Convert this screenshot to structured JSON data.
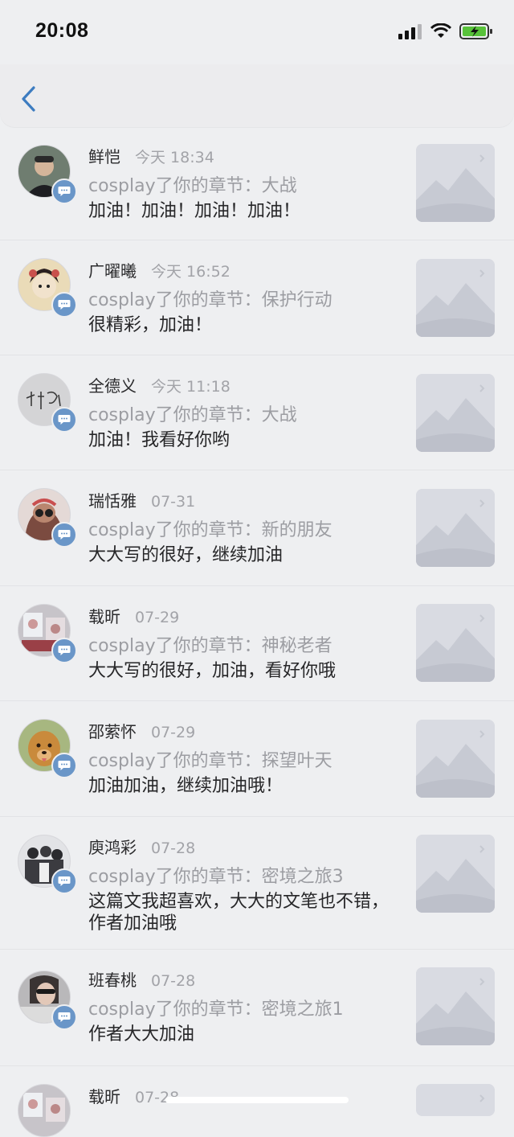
{
  "status_bar": {
    "time": "20:08"
  },
  "nav": {
    "back_icon": "chevron-left-icon"
  },
  "notifications": [
    {
      "name": "鲜恺",
      "time": "今天 18:34",
      "action": "cosplay了你的章节：大战",
      "comment": "加油！加油！加油！加油！"
    },
    {
      "name": "广曜曦",
      "time": "今天 16:52",
      "action": "cosplay了你的章节：保护行动",
      "comment": "很精彩，加油！"
    },
    {
      "name": "全德义",
      "time": "今天 11:18",
      "action": "cosplay了你的章节：大战",
      "comment": "加油！我看好你哟"
    },
    {
      "name": "瑞恬雅",
      "time": "07-31",
      "action": "cosplay了你的章节：新的朋友",
      "comment": "大大写的很好，继续加油"
    },
    {
      "name": "载昕",
      "time": "07-29",
      "action": "cosplay了你的章节：神秘老者",
      "comment": "大大写的很好，加油，看好你哦"
    },
    {
      "name": "邵萦怀",
      "time": "07-29",
      "action": "cosplay了你的章节：探望叶天",
      "comment": "加油加油，继续加油哦！"
    },
    {
      "name": "庾鸿彩",
      "time": "07-28",
      "action": "cosplay了你的章节：密境之旅3",
      "comment": "这篇文我超喜欢，大大的文笔也不错，作者加油哦"
    },
    {
      "name": "班春桃",
      "time": "07-28",
      "action": "cosplay了你的章节：密境之旅1",
      "comment": "作者大大加油"
    },
    {
      "name": "载昕",
      "time": "07-28",
      "action": "",
      "comment": ""
    }
  ],
  "colors": {
    "background": "#eeeff1",
    "accent": "#3d7cc0",
    "badge": "#6a96c8"
  }
}
